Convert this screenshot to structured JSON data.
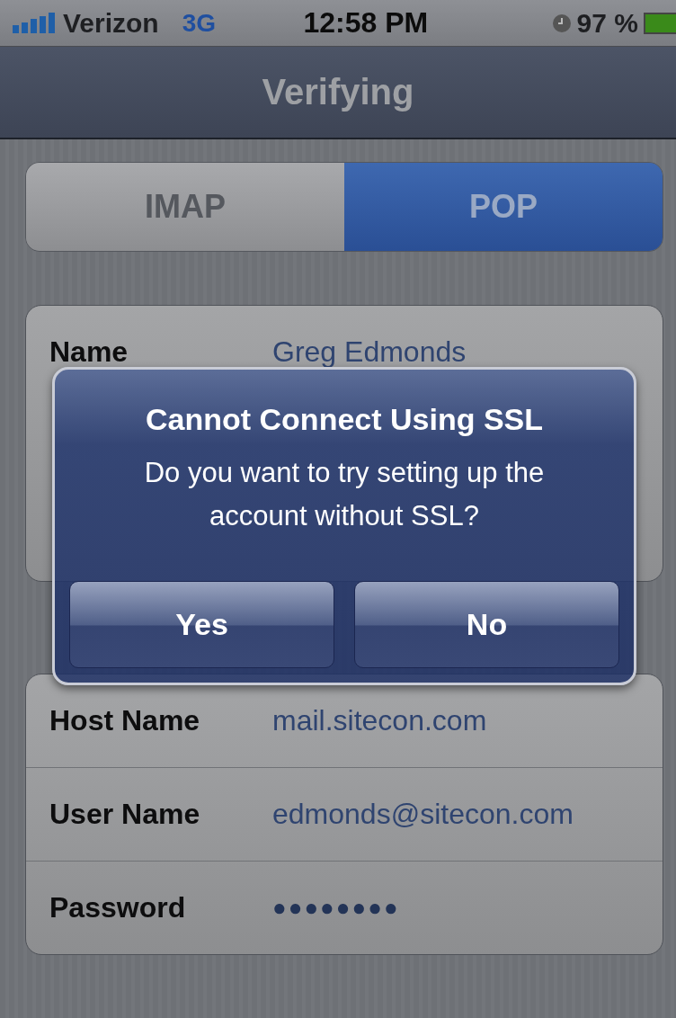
{
  "status_bar": {
    "carrier": "Verizon",
    "network": "3G",
    "time": "12:58 PM",
    "battery": "97 %"
  },
  "nav_bar": {
    "title": "Verifying"
  },
  "segments": [
    {
      "label": "IMAP",
      "selected": false
    },
    {
      "label": "POP",
      "selected": true
    }
  ],
  "account_fields": [
    {
      "label": "Name",
      "value": "Greg Edmonds",
      "kind": "text"
    }
  ],
  "incoming_fields": [
    {
      "label": "Host Name",
      "value": "mail.sitecon.com",
      "kind": "text"
    },
    {
      "label": "User Name",
      "value": "edmonds@sitecon.com",
      "kind": "text"
    },
    {
      "label": "Password",
      "value": "●●●●●●●●",
      "kind": "password"
    }
  ],
  "alert": {
    "title": "Cannot Connect Using SSL",
    "message": "Do you want to try setting up the account without SSL?",
    "buttons": [
      "Yes",
      "No"
    ]
  }
}
